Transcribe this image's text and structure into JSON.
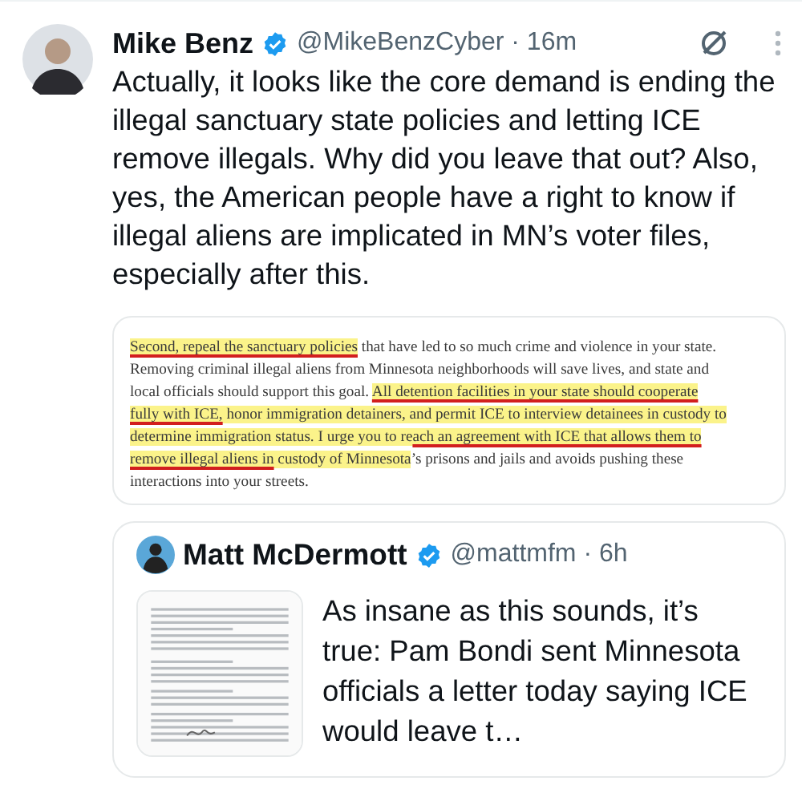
{
  "tweet": {
    "author": {
      "name": "Mike Benz",
      "verified": true,
      "handle_time": "@MikeBenzCyber · 16m"
    },
    "text": "Actually, it looks like the core demand is ending the illegal sanctuary state policies and letting ICE remove illegals. Why did you leave that out? Also, yes, the American people have a right to know if illegal aliens are implicated in MN’s voter files, especially after this.",
    "document": {
      "lines": [
        [
          {
            "text": "Second, repeal the sanctuary policies",
            "highlighted": true,
            "underlined": true
          },
          {
            "text": " that have led to so much crime and violence in your state.",
            "highlighted": false,
            "underlined": false
          }
        ],
        [
          {
            "text": "Removing criminal illegal aliens from Minnesota neighborhoods will save lives, and state and",
            "highlighted": false,
            "underlined": false
          }
        ],
        [
          {
            "text": "local officials should support this goal. ",
            "highlighted": false,
            "underlined": false
          },
          {
            "text": "All detention facilities in your state should cooperate",
            "highlighted": true,
            "underlined": true
          }
        ],
        [
          {
            "text": "fully with ICE,",
            "highlighted": true,
            "underlined": true
          },
          {
            "text": " honor immigration detainers, and permit ICE to interview detainees in custody to",
            "highlighted": true,
            "underlined": false
          }
        ],
        [
          {
            "text": "determine immigration status. I urge you to re",
            "highlighted": true,
            "underlined": false
          },
          {
            "text": "ach an agreement with ICE that allows them to",
            "highlighted": true,
            "underlined": true
          }
        ],
        [
          {
            "text": "remove illegal aliens in",
            "highlighted": true,
            "underlined": true
          },
          {
            "text": " custody of Minnesota",
            "highlighted": true,
            "underlined": false
          },
          {
            "text": "’s prisons and jails and avoids pushing these",
            "highlighted": false,
            "underlined": false
          }
        ],
        [
          {
            "text": "interactions into your streets.",
            "highlighted": false,
            "underlined": false
          }
        ]
      ]
    },
    "quote": {
      "author": {
        "name": "Matt McDermott",
        "verified": true,
        "handle_time": "@mattmfm · 6h"
      },
      "text": "As insane as this sounds, it’s true: Pam Bondi sent Minnesota officials a letter today saying ICE would leave t…"
    }
  }
}
